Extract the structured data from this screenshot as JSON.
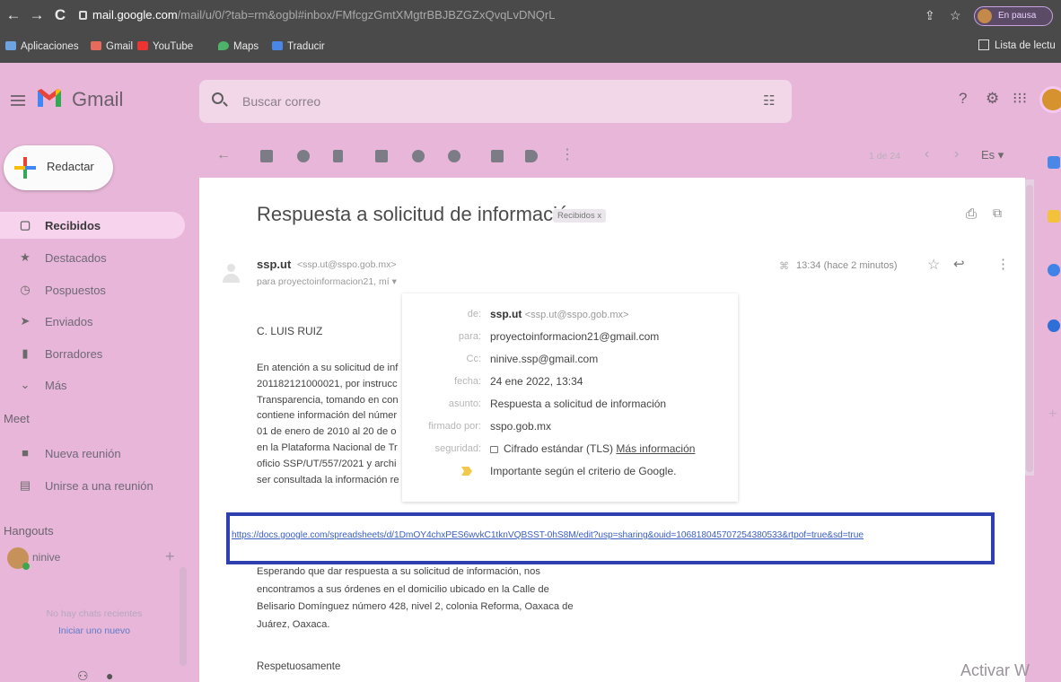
{
  "browser": {
    "url_host": "mail.google.com",
    "url_path": "/mail/u/0/?tab=rm&ogbl#inbox/FMfcgzGmtXMgtrBBJBZGZxQvqLvDNQrL",
    "profile_label": "En pausa",
    "bookmarks": [
      "Aplicaciones",
      "Gmail",
      "YouTube",
      "Maps",
      "Traducir"
    ],
    "reading_list": "Lista de lectu"
  },
  "app": {
    "name": "Gmail",
    "search_placeholder": "Buscar correo"
  },
  "nav": {
    "compose": "Redactar",
    "items": [
      {
        "icon": "inbox-icon",
        "label": "Recibidos"
      },
      {
        "icon": "star-icon",
        "label": "Destacados"
      },
      {
        "icon": "clock-icon",
        "label": "Pospuestos"
      },
      {
        "icon": "send-icon",
        "label": "Enviados"
      },
      {
        "icon": "draft-icon",
        "label": "Borradores"
      },
      {
        "icon": "chevron-down-icon",
        "label": "Más"
      }
    ],
    "meet_title": "Meet",
    "meet_items": [
      {
        "icon": "video-icon",
        "label": "Nueva reunión"
      },
      {
        "icon": "keyboard-icon",
        "label": "Unirse a una reunión"
      }
    ],
    "hangouts_title": "Hangouts",
    "hangouts_user": "ninive",
    "no_chats": "No hay chats recientes",
    "start_new": "Iniciar uno nuevo"
  },
  "toolbar": {
    "pager": "1 de 24",
    "language": "Es"
  },
  "message": {
    "subject": "Respuesta a solicitud de información",
    "label": "Recibidos x",
    "sender_name": "ssp.ut",
    "sender_email": "<ssp.ut@sspo.gob.mx>",
    "to_line": "para proyectoinformacion21, mí ▾",
    "time": "13:34 (hace 2 minutos)",
    "greeting": "C. LUIS RUIZ",
    "body_left": [
      "En atención a su solicitud de inf",
      "201182121000021, por instrucc",
      "Transparencia, tomando en con",
      "contiene información del númer",
      "01 de enero de 2010 al 20 de o",
      "en la Plataforma Nacional de Tr",
      "oficio SSP/UT/557/2021 y archi",
      "ser consultada la información re"
    ],
    "link": "https://docs.google.com/spreadsheets/d/1DmOY4chxPES6wvkC1tknVQBSST-0hS8M/edit?usp=sharing&ouid=106818045707254380533&rtpof=true&sd=true",
    "body_bottom": [
      "Esperando que dar respuesta a su solicitud de información, nos",
      "encontramos a sus órdenes en el domicilio ubicado en la Calle de",
      "Belisario Domínguez número 428, nivel 2, colonia Reforma, Oaxaca de",
      "Juárez, Oaxaca."
    ],
    "closing": "Respetuosamente"
  },
  "details": {
    "de_key": "de:",
    "de_name": "ssp.ut",
    "de_email": "<ssp.ut@sspo.gob.mx>",
    "para_key": "para:",
    "para_val": "proyectoinformacion21@gmail.com",
    "cc_key": "Cc:",
    "cc_val": "ninive.ssp@gmail.com",
    "fecha_key": "fecha:",
    "fecha_val": "24 ene 2022, 13:34",
    "asunto_key": "asunto:",
    "asunto_val": "Respuesta a solicitud de información",
    "firmado_key": "firmado por:",
    "firmado_val": "sspo.gob.mx",
    "seguridad_key": "seguridad:",
    "seguridad_val": "Cifrado estándar (TLS)",
    "more_info": "Más información",
    "importance": "Importante según el criterio de Google."
  },
  "watermark": "Activar W"
}
